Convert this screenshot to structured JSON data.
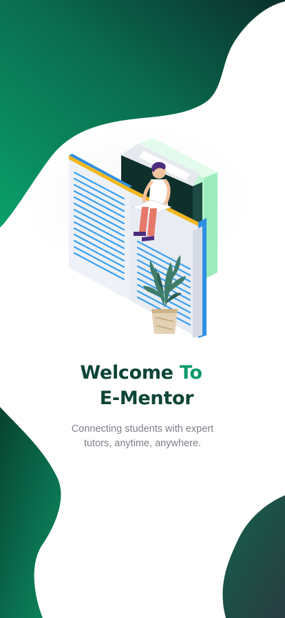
{
  "welcome": {
    "title_part1": "Welcome",
    "title_part2": "To",
    "title_line2": "E-Mentor",
    "subtitle_line1": "Connecting students with expert",
    "subtitle_line2": "tutors, anytime, anywhere."
  },
  "colors": {
    "brand_green": "#0c9a6b",
    "brand_dark": "#0d4536",
    "subtitle_gray": "#7b7f86"
  },
  "icons": {
    "illustration": "student-reading-on-books-illustration"
  }
}
